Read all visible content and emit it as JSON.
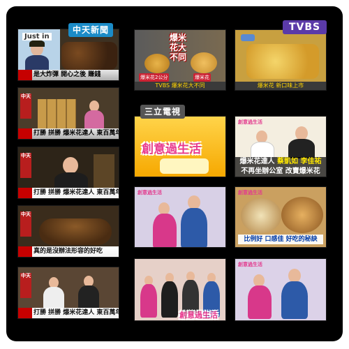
{
  "channels": {
    "cti": "中天新聞",
    "tvbs": "TVBS",
    "set": "三立電視"
  },
  "cti_clips": [
    {
      "overlay": "Just in",
      "ticker": "是大炸彈 開心之後 賺錢"
    },
    {
      "ticker": "打勝 拼勝 爆米花達人 東百萬年薪"
    },
    {
      "ticker": "打勝 拼勝 爆米花達人 東百萬年薪"
    },
    {
      "ticker": "真的是沒辦法形容的好吃"
    },
    {
      "ticker": "打勝 拼勝 爆米花達人 東百萬年薪"
    }
  ],
  "cti_side_logo": "中天",
  "tvbs_clips": [
    {
      "title": "爆米花大不同",
      "left_label": "爆米花2公分",
      "right_label": "爆米花",
      "ticker": "TVBS 爆米花大不同"
    },
    {
      "ticker": "爆米花 新口味上市"
    }
  ],
  "set_clips": [
    {
      "show": "創意過生活"
    },
    {
      "show_small": "創意過生活",
      "line1": "爆米花達人",
      "names": "蔡凱如 李佳祐",
      "line2": "不再坐辦公室 改賣爆米花"
    },
    {
      "show_small": "創意過生活"
    },
    {
      "show_small": "創意過生活",
      "caption": "比例好 口感佳 好吃的秘訣"
    },
    {
      "show": "創意過生活"
    },
    {
      "show_small": "創意過生活"
    }
  ]
}
